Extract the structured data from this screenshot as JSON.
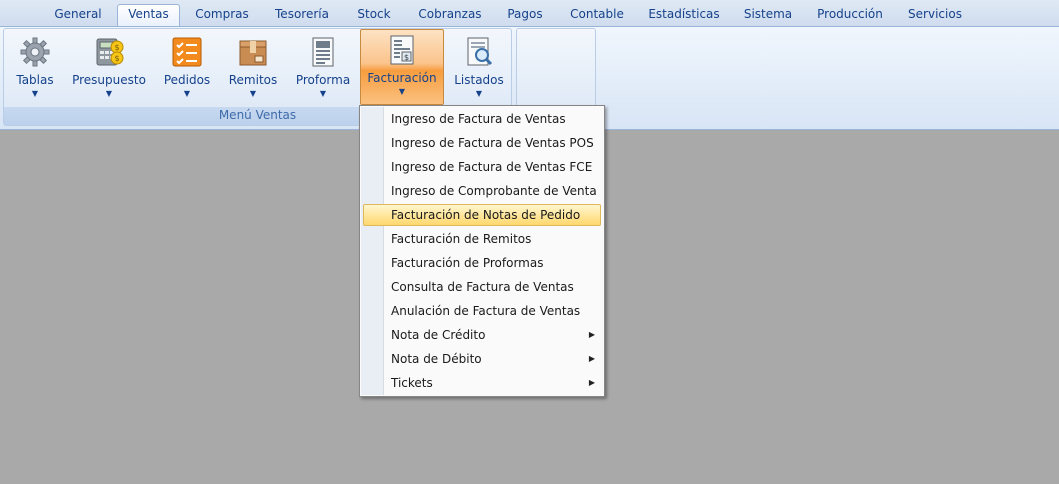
{
  "tabs": [
    "General",
    "Ventas",
    "Compras",
    "Tesorería",
    "Stock",
    "Cobranzas",
    "Pagos",
    "Contable",
    "Estadísticas",
    "Sistema",
    "Producción",
    "Servicios"
  ],
  "active_tab": "Ventas",
  "group": {
    "label": "Menú Ventas",
    "buttons": [
      {
        "label": "Tablas",
        "icon": "gear-icon"
      },
      {
        "label": "Presupuesto",
        "icon": "calculator-icon"
      },
      {
        "label": "Pedidos",
        "icon": "checklist-icon"
      },
      {
        "label": "Remitos",
        "icon": "package-icon"
      },
      {
        "label": "Proforma",
        "icon": "document-icon"
      },
      {
        "label": "Facturación",
        "icon": "invoice-icon"
      },
      {
        "label": "Listados",
        "icon": "search-report-icon"
      }
    ],
    "active_button": "Facturación"
  },
  "dropdown": {
    "items": [
      {
        "label": "Ingreso de Factura de Ventas"
      },
      {
        "label": "Ingreso de Factura de Ventas POS"
      },
      {
        "label": "Ingreso de Factura de Ventas FCE"
      },
      {
        "label": "Ingreso de Comprobante de Venta"
      },
      {
        "label": "Facturación de Notas de Pedido"
      },
      {
        "label": "Facturación de Remitos"
      },
      {
        "label": "Facturación de Proformas"
      },
      {
        "label": "Consulta de Factura de Ventas"
      },
      {
        "label": "Anulación de Factura de Ventas"
      },
      {
        "label": "Nota de Crédito"
      },
      {
        "label": "Nota de Débito"
      },
      {
        "label": "Tickets"
      }
    ],
    "highlighted": "Facturación de Notas de Pedido",
    "submenu_items": [
      "Nota de Crédito",
      "Nota de Débito",
      "Tickets"
    ]
  },
  "colors": {
    "workspace": "#a9a9a9",
    "ribbon_text": "#15428b",
    "active_button": "#f79d3f",
    "menu_highlight": "#ffd86e"
  }
}
